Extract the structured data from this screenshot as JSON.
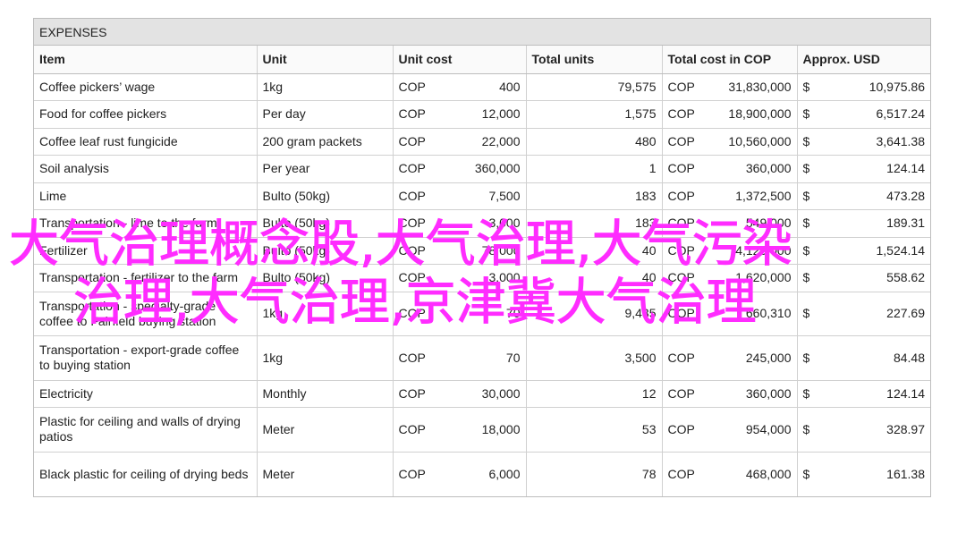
{
  "table": {
    "title": "EXPENSES",
    "headers": [
      "Item",
      "Unit",
      "Unit cost",
      "Total units",
      "Total cost in COP",
      "Approx. USD"
    ],
    "rows": [
      {
        "item": "Coffee pickers’ wage",
        "unit": "1kg",
        "cur": "COP",
        "unit_cost": "400",
        "total_units": "79,575",
        "cur2": "COP",
        "total_cost": "31,830,000",
        "usd_sym": "$",
        "usd": "10,975.86"
      },
      {
        "item": "Food for coffee pickers",
        "unit": "Per day",
        "cur": "COP",
        "unit_cost": "12,000",
        "total_units": "1,575",
        "cur2": "COP",
        "total_cost": "18,900,000",
        "usd_sym": "$",
        "usd": "6,517.24"
      },
      {
        "item": "Coffee leaf rust fungicide",
        "unit": "200 gram packets",
        "cur": "COP",
        "unit_cost": "22,000",
        "total_units": "480",
        "cur2": "COP",
        "total_cost": "10,560,000",
        "usd_sym": "$",
        "usd": "3,641.38"
      },
      {
        "item": "Soil analysis",
        "unit": "Per year",
        "cur": "COP",
        "unit_cost": "360,000",
        "total_units": "1",
        "cur2": "COP",
        "total_cost": "360,000",
        "usd_sym": "$",
        "usd": "124.14"
      },
      {
        "item": "Lime",
        "unit": "Bulto (50kg)",
        "cur": "COP",
        "unit_cost": "7,500",
        "total_units": "183",
        "cur2": "COP",
        "total_cost": "1,372,500",
        "usd_sym": "$",
        "usd": "473.28"
      },
      {
        "item": "Transportation - lime to the farm",
        "unit": "Bulto (50kg)",
        "cur": "COP",
        "unit_cost": "3,000",
        "total_units": "183",
        "cur2": "COP",
        "total_cost": "549,000",
        "usd_sym": "$",
        "usd": "189.31"
      },
      {
        "item": "Fertilizer",
        "unit": "Bulto (50kg)",
        "cur": "COP",
        "unit_cost": "78,000",
        "total_units": "40",
        "cur2": "COP",
        "total_cost": "4,120,000",
        "usd_sym": "$",
        "usd": "1,524.14"
      },
      {
        "item": "Transportation - fertilizer to the farm",
        "unit": "Bulto (50kg)",
        "cur": "COP",
        "unit_cost": "3,000",
        "total_units": "40",
        "cur2": "COP",
        "total_cost": "1,620,000",
        "usd_sym": "$",
        "usd": "558.62"
      },
      {
        "item": "Transportation - specialty-grade coffee to Fairfield buying station",
        "unit": "1kg",
        "cur": "COP",
        "unit_cost": "70",
        "total_units": "9,435",
        "cur2": "COP",
        "total_cost": "660,310",
        "usd_sym": "$",
        "usd": "227.69"
      },
      {
        "item": "Transportation - export-grade coffee to buying station",
        "unit": "1kg",
        "cur": "COP",
        "unit_cost": "70",
        "total_units": "3,500",
        "cur2": "COP",
        "total_cost": "245,000",
        "usd_sym": "$",
        "usd": "84.48"
      },
      {
        "item": "Electricity",
        "unit": "Monthly",
        "cur": "COP",
        "unit_cost": "30,000",
        "total_units": "12",
        "cur2": "COP",
        "total_cost": "360,000",
        "usd_sym": "$",
        "usd": "124.14"
      },
      {
        "item": "Plastic for ceiling and walls of drying patios",
        "unit": "Meter",
        "cur": "COP",
        "unit_cost": "18,000",
        "total_units": "53",
        "cur2": "COP",
        "total_cost": "954,000",
        "usd_sym": "$",
        "usd": "328.97"
      },
      {
        "item": "Black plastic for ceiling of drying beds",
        "unit": "Meter",
        "cur": "COP",
        "unit_cost": "6,000",
        "total_units": "78",
        "cur2": "COP",
        "total_cost": "468,000",
        "usd_sym": "$",
        "usd": "161.38"
      }
    ]
  },
  "overlay": {
    "line1": "大气治理概念股,大气治理,大气污染",
    "line2": "治理,大气治理,京津冀大气治理",
    "color": "#ff2cff"
  }
}
